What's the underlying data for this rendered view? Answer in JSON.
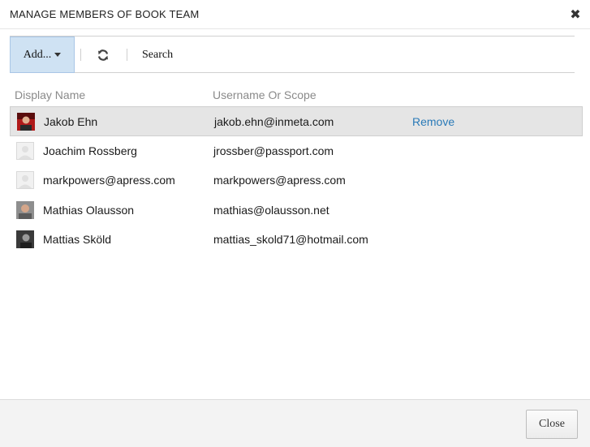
{
  "dialog": {
    "title": "MANAGE MEMBERS OF BOOK TEAM",
    "close_glyph": "✖"
  },
  "toolbar": {
    "add_label": "Add...",
    "refresh_icon": "refresh-icon",
    "search_label": "Search"
  },
  "table": {
    "headers": {
      "display_name": "Display Name",
      "username": "Username Or Scope"
    },
    "rows": [
      {
        "name": "Jakob Ehn",
        "username": "jakob.ehn@inmeta.com",
        "action": "Remove",
        "avatar": "photo-red"
      },
      {
        "name": "Joachim Rossberg",
        "username": "jrossber@passport.com",
        "avatar": "placeholder"
      },
      {
        "name": "markpowers@apress.com",
        "username": "markpowers@apress.com",
        "avatar": "placeholder"
      },
      {
        "name": "Mathias Olausson",
        "username": "mathias@olausson.net",
        "avatar": "photo-portrait"
      },
      {
        "name": "Mattias Sköld",
        "username": "mattias_skold71@hotmail.com",
        "avatar": "photo-dark"
      }
    ]
  },
  "footer": {
    "close_label": "Close"
  },
  "colors": {
    "accent_button": "#cfe2f3",
    "link": "#2a7ab8",
    "selected_row": "#e5e5e5"
  }
}
